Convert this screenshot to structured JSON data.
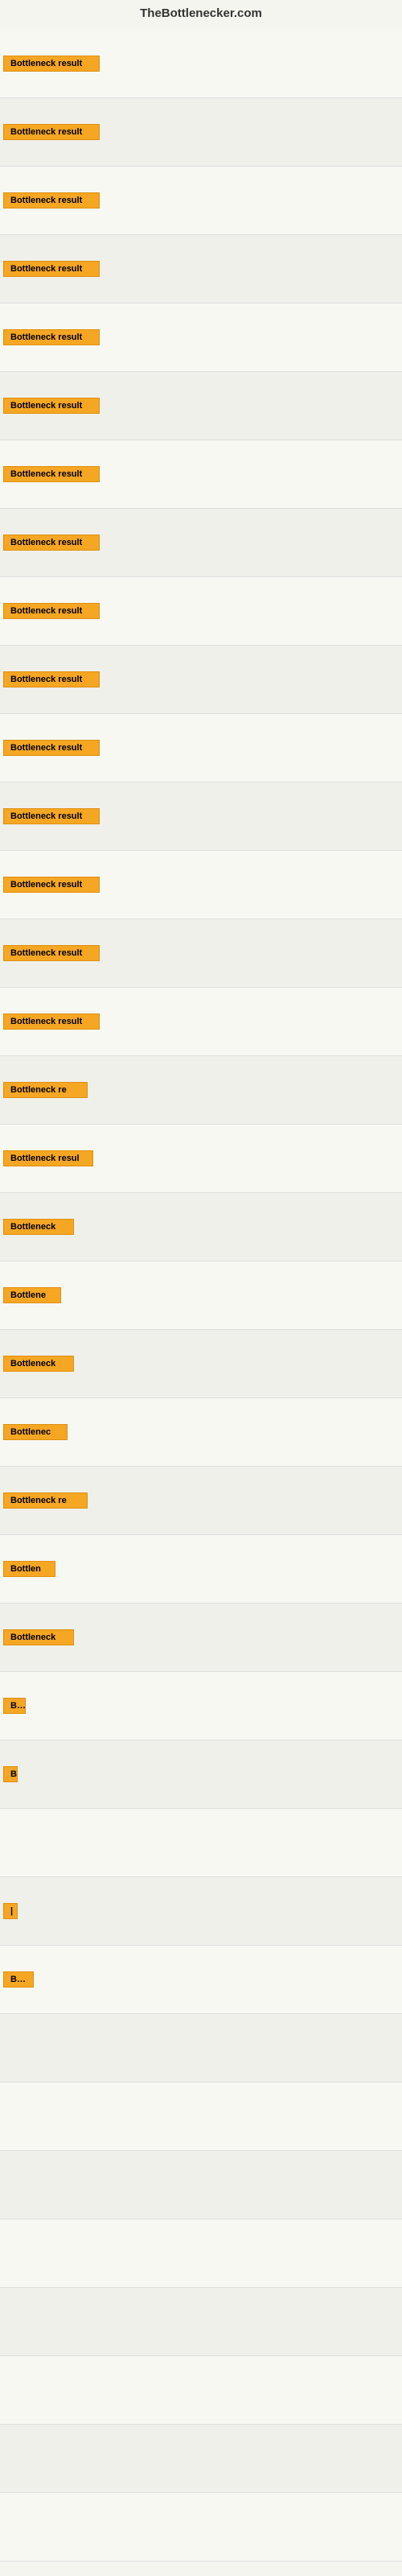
{
  "header": {
    "title": "TheBottlenecker.com"
  },
  "rows": [
    {
      "label": "Bottleneck result",
      "width": 120
    },
    {
      "label": "Bottleneck result",
      "width": 120
    },
    {
      "label": "Bottleneck result",
      "width": 120
    },
    {
      "label": "Bottleneck result",
      "width": 120
    },
    {
      "label": "Bottleneck result",
      "width": 120
    },
    {
      "label": "Bottleneck result",
      "width": 120
    },
    {
      "label": "Bottleneck result",
      "width": 120
    },
    {
      "label": "Bottleneck result",
      "width": 120
    },
    {
      "label": "Bottleneck result",
      "width": 120
    },
    {
      "label": "Bottleneck result",
      "width": 120
    },
    {
      "label": "Bottleneck result",
      "width": 120
    },
    {
      "label": "Bottleneck result",
      "width": 120
    },
    {
      "label": "Bottleneck result",
      "width": 120
    },
    {
      "label": "Bottleneck result",
      "width": 120
    },
    {
      "label": "Bottleneck result",
      "width": 120
    },
    {
      "label": "Bottleneck re",
      "width": 105
    },
    {
      "label": "Bottleneck resul",
      "width": 112
    },
    {
      "label": "Bottleneck",
      "width": 88
    },
    {
      "label": "Bottlene",
      "width": 72
    },
    {
      "label": "Bottleneck",
      "width": 88
    },
    {
      "label": "Bottlenec",
      "width": 80
    },
    {
      "label": "Bottleneck re",
      "width": 105
    },
    {
      "label": "Bottlen",
      "width": 65
    },
    {
      "label": "Bottleneck",
      "width": 88
    },
    {
      "label": "Bo",
      "width": 28
    },
    {
      "label": "B",
      "width": 16
    },
    {
      "label": "",
      "width": 10
    },
    {
      "label": "|",
      "width": 8
    },
    {
      "label": "Bott",
      "width": 38
    },
    {
      "label": "",
      "width": 0
    },
    {
      "label": "",
      "width": 0
    },
    {
      "label": "",
      "width": 0
    },
    {
      "label": "",
      "width": 0
    },
    {
      "label": "",
      "width": 0
    },
    {
      "label": "",
      "width": 0
    },
    {
      "label": "",
      "width": 0
    },
    {
      "label": "",
      "width": 0
    }
  ]
}
